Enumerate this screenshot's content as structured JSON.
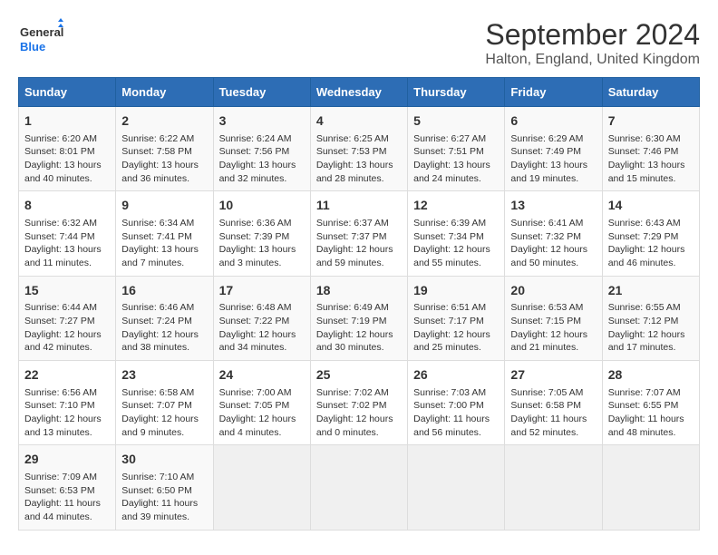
{
  "logo": {
    "line1": "General",
    "line2": "Blue"
  },
  "title": "September 2024",
  "subtitle": "Halton, England, United Kingdom",
  "days_of_week": [
    "Sunday",
    "Monday",
    "Tuesday",
    "Wednesday",
    "Thursday",
    "Friday",
    "Saturday"
  ],
  "weeks": [
    [
      {
        "day": 1,
        "sunrise": "6:20 AM",
        "sunset": "8:01 PM",
        "daylight": "13 hours and 40 minutes."
      },
      {
        "day": 2,
        "sunrise": "6:22 AM",
        "sunset": "7:58 PM",
        "daylight": "13 hours and 36 minutes."
      },
      {
        "day": 3,
        "sunrise": "6:24 AM",
        "sunset": "7:56 PM",
        "daylight": "13 hours and 32 minutes."
      },
      {
        "day": 4,
        "sunrise": "6:25 AM",
        "sunset": "7:53 PM",
        "daylight": "13 hours and 28 minutes."
      },
      {
        "day": 5,
        "sunrise": "6:27 AM",
        "sunset": "7:51 PM",
        "daylight": "13 hours and 24 minutes."
      },
      {
        "day": 6,
        "sunrise": "6:29 AM",
        "sunset": "7:49 PM",
        "daylight": "13 hours and 19 minutes."
      },
      {
        "day": 7,
        "sunrise": "6:30 AM",
        "sunset": "7:46 PM",
        "daylight": "13 hours and 15 minutes."
      }
    ],
    [
      {
        "day": 8,
        "sunrise": "6:32 AM",
        "sunset": "7:44 PM",
        "daylight": "13 hours and 11 minutes."
      },
      {
        "day": 9,
        "sunrise": "6:34 AM",
        "sunset": "7:41 PM",
        "daylight": "13 hours and 7 minutes."
      },
      {
        "day": 10,
        "sunrise": "6:36 AM",
        "sunset": "7:39 PM",
        "daylight": "13 hours and 3 minutes."
      },
      {
        "day": 11,
        "sunrise": "6:37 AM",
        "sunset": "7:37 PM",
        "daylight": "12 hours and 59 minutes."
      },
      {
        "day": 12,
        "sunrise": "6:39 AM",
        "sunset": "7:34 PM",
        "daylight": "12 hours and 55 minutes."
      },
      {
        "day": 13,
        "sunrise": "6:41 AM",
        "sunset": "7:32 PM",
        "daylight": "12 hours and 50 minutes."
      },
      {
        "day": 14,
        "sunrise": "6:43 AM",
        "sunset": "7:29 PM",
        "daylight": "12 hours and 46 minutes."
      }
    ],
    [
      {
        "day": 15,
        "sunrise": "6:44 AM",
        "sunset": "7:27 PM",
        "daylight": "12 hours and 42 minutes."
      },
      {
        "day": 16,
        "sunrise": "6:46 AM",
        "sunset": "7:24 PM",
        "daylight": "12 hours and 38 minutes."
      },
      {
        "day": 17,
        "sunrise": "6:48 AM",
        "sunset": "7:22 PM",
        "daylight": "12 hours and 34 minutes."
      },
      {
        "day": 18,
        "sunrise": "6:49 AM",
        "sunset": "7:19 PM",
        "daylight": "12 hours and 30 minutes."
      },
      {
        "day": 19,
        "sunrise": "6:51 AM",
        "sunset": "7:17 PM",
        "daylight": "12 hours and 25 minutes."
      },
      {
        "day": 20,
        "sunrise": "6:53 AM",
        "sunset": "7:15 PM",
        "daylight": "12 hours and 21 minutes."
      },
      {
        "day": 21,
        "sunrise": "6:55 AM",
        "sunset": "7:12 PM",
        "daylight": "12 hours and 17 minutes."
      }
    ],
    [
      {
        "day": 22,
        "sunrise": "6:56 AM",
        "sunset": "7:10 PM",
        "daylight": "12 hours and 13 minutes."
      },
      {
        "day": 23,
        "sunrise": "6:58 AM",
        "sunset": "7:07 PM",
        "daylight": "12 hours and 9 minutes."
      },
      {
        "day": 24,
        "sunrise": "7:00 AM",
        "sunset": "7:05 PM",
        "daylight": "12 hours and 4 minutes."
      },
      {
        "day": 25,
        "sunrise": "7:02 AM",
        "sunset": "7:02 PM",
        "daylight": "12 hours and 0 minutes."
      },
      {
        "day": 26,
        "sunrise": "7:03 AM",
        "sunset": "7:00 PM",
        "daylight": "11 hours and 56 minutes."
      },
      {
        "day": 27,
        "sunrise": "7:05 AM",
        "sunset": "6:58 PM",
        "daylight": "11 hours and 52 minutes."
      },
      {
        "day": 28,
        "sunrise": "7:07 AM",
        "sunset": "6:55 PM",
        "daylight": "11 hours and 48 minutes."
      }
    ],
    [
      {
        "day": 29,
        "sunrise": "7:09 AM",
        "sunset": "6:53 PM",
        "daylight": "11 hours and 44 minutes."
      },
      {
        "day": 30,
        "sunrise": "7:10 AM",
        "sunset": "6:50 PM",
        "daylight": "11 hours and 39 minutes."
      },
      null,
      null,
      null,
      null,
      null
    ]
  ]
}
